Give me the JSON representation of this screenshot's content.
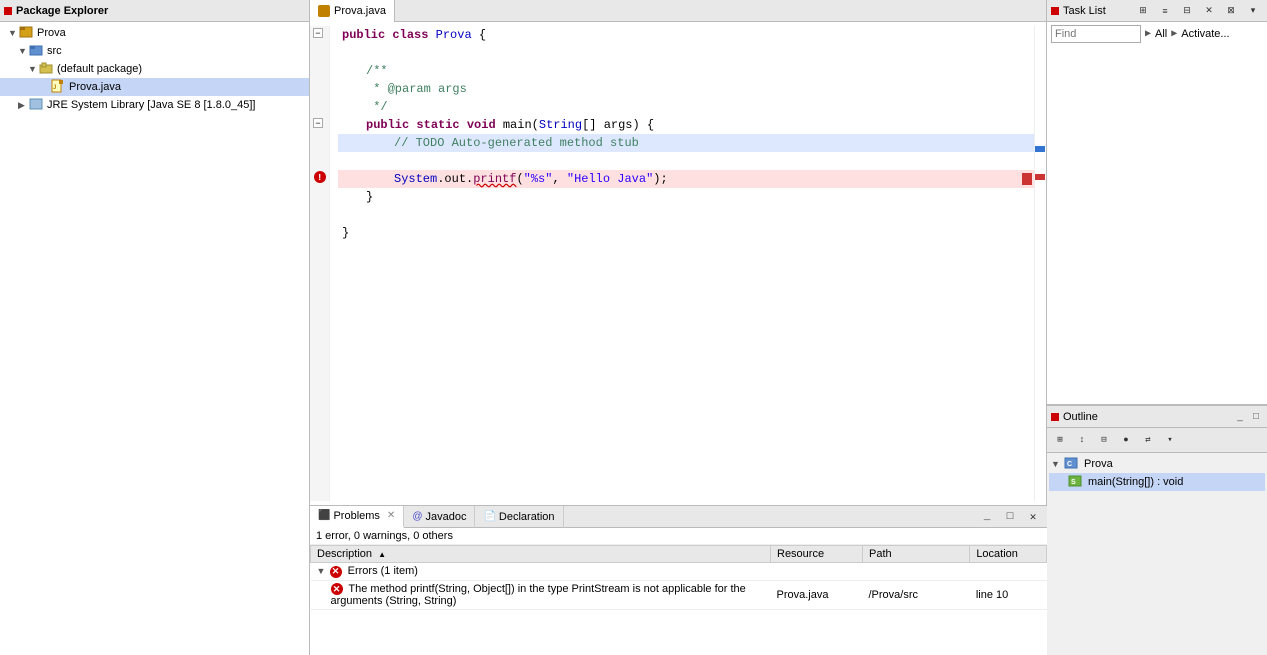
{
  "packageExplorer": {
    "title": "Package Explorer",
    "items": [
      {
        "id": "prova",
        "label": "Prova",
        "level": 0,
        "type": "project",
        "expanded": true
      },
      {
        "id": "src",
        "label": "src",
        "level": 1,
        "type": "src",
        "expanded": true
      },
      {
        "id": "defaultpkg",
        "label": "(default package)",
        "level": 2,
        "type": "package",
        "expanded": true
      },
      {
        "id": "provajava",
        "label": "Prova.java",
        "level": 3,
        "type": "java",
        "selected": true
      },
      {
        "id": "jre",
        "label": "JRE System Library [Java SE 8 [1.8.0_45]]",
        "level": 1,
        "type": "jre",
        "expanded": false
      }
    ]
  },
  "editor": {
    "tab": "Prova.java",
    "lines": [
      {
        "num": "",
        "code": "public class Prova {",
        "type": "normal"
      },
      {
        "num": "",
        "code": "",
        "type": "normal"
      },
      {
        "num": "",
        "code": "    /**",
        "type": "comment"
      },
      {
        "num": "",
        "code": "     * @param args",
        "type": "comment"
      },
      {
        "num": "",
        "code": "     */",
        "type": "comment"
      },
      {
        "num": "",
        "code": "    public static void main(String[] args) {",
        "type": "normal"
      },
      {
        "num": "",
        "code": "        // TODO Auto-generated method stub",
        "type": "comment"
      },
      {
        "num": "",
        "code": "",
        "type": "normal"
      },
      {
        "num": "",
        "code": "        System.out.printf(\"%s\", \"Hello Java\");",
        "type": "error-highlight"
      },
      {
        "num": "",
        "code": "    }",
        "type": "normal"
      },
      {
        "num": "",
        "code": "",
        "type": "normal"
      },
      {
        "num": "",
        "code": "}",
        "type": "normal"
      }
    ]
  },
  "taskList": {
    "title": "Task List",
    "findPlaceholder": "Find",
    "allLabel": "All",
    "activateLabel": "Activate..."
  },
  "outline": {
    "title": "Outline",
    "items": [
      {
        "label": "Prova",
        "level": 0,
        "type": "class"
      },
      {
        "label": "main(String[]) : void",
        "level": 1,
        "type": "method",
        "selected": true
      }
    ]
  },
  "bottomPanel": {
    "tabs": [
      {
        "id": "problems",
        "label": "Problems",
        "active": true
      },
      {
        "id": "javadoc",
        "label": "Javadoc",
        "active": false
      },
      {
        "id": "declaration",
        "label": "Declaration",
        "active": false
      }
    ],
    "errorSummary": "1 error, 0 warnings, 0 others",
    "columns": [
      {
        "id": "description",
        "label": "Description"
      },
      {
        "id": "resource",
        "label": "Resource"
      },
      {
        "id": "path",
        "label": "Path"
      },
      {
        "id": "location",
        "label": "Location"
      }
    ],
    "errorGroups": [
      {
        "id": "errors",
        "label": "Errors (1 item)",
        "expanded": true,
        "items": [
          {
            "description": "The method printf(String, Object[]) in the type PrintStream is not applicable for the arguments (String, String)",
            "resource": "Prova.java",
            "path": "/Prova/src",
            "location": "line 10"
          }
        ]
      }
    ]
  }
}
